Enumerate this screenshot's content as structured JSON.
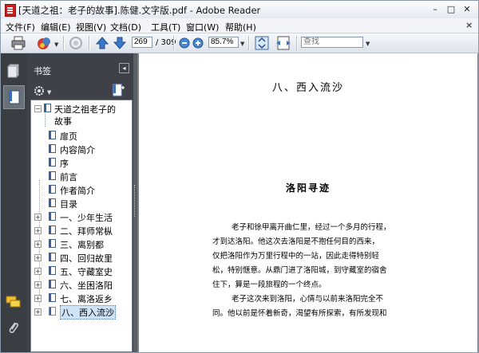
{
  "window": {
    "title": "[天道之祖：老子的故事].陈健.文字版.pdf - Adobe Reader",
    "min_glyph": "–",
    "max_glyph": "□",
    "close_glyph": "✕"
  },
  "menu": {
    "items": [
      "文件(F)",
      "编辑(E)",
      "视图(V)",
      "文档(D)",
      "工具(T)",
      "窗口(W)",
      "帮助(H)"
    ],
    "close_glyph": "×"
  },
  "toolbar": {
    "page_current": "269",
    "page_total": "/ 309",
    "zoom": "85.7%",
    "search_placeholder": "查找"
  },
  "bookmarks": {
    "title": "书签",
    "collapse_glyph": "◂",
    "items": [
      {
        "label": "天道之祖老子的",
        "level": 0,
        "expander": "−"
      },
      {
        "label": "故事",
        "level": 0,
        "expander": ""
      },
      {
        "label": "扉页",
        "level": 1,
        "expander": ""
      },
      {
        "label": "内容简介",
        "level": 1,
        "expander": ""
      },
      {
        "label": "序",
        "level": 1,
        "expander": ""
      },
      {
        "label": "前言",
        "level": 1,
        "expander": ""
      },
      {
        "label": "作者简介",
        "level": 1,
        "expander": ""
      },
      {
        "label": "目录",
        "level": 1,
        "expander": ""
      },
      {
        "label": "一、少年生活",
        "level": 1,
        "expander": "+"
      },
      {
        "label": "二、拜师常枞",
        "level": 1,
        "expander": "+"
      },
      {
        "label": "三、离别都",
        "level": 1,
        "expander": "+"
      },
      {
        "label": "四、回归故里",
        "level": 1,
        "expander": "+"
      },
      {
        "label": "五、守藏室史",
        "level": 1,
        "expander": "+"
      },
      {
        "label": "六、坐困洛阳",
        "level": 1,
        "expander": "+"
      },
      {
        "label": "七、离洛返乡",
        "level": 1,
        "expander": "+"
      },
      {
        "label": "八、西入流沙",
        "level": 1,
        "expander": "+"
      }
    ]
  },
  "document": {
    "chapter_title": "八、西入流沙",
    "section_title": "洛阳寻迹",
    "lines": [
      "老子和徐甲离开曲仁里，经过一个多月的行程，",
      "才到达洛阳。他这次去洛阳是不抱任何目的西来，",
      "仅把洛阳作为万里行程中的一站，因此走得特别轻",
      "松，特别惬意。从鼎门进了洛阳城，到守藏室的宿舍",
      "住下，算是一段旅程的一个终点。",
      "老子这次来到洛阳，心情与以前来洛阳完全不",
      "同。他以前是怀着新奇，渴望有所探索，有所发现和"
    ]
  },
  "colors": {
    "accent": "#3c5f93",
    "panel_bg": "#3e4248",
    "doc_bg": "#7b7f85",
    "selection": "#cfe3f7"
  }
}
